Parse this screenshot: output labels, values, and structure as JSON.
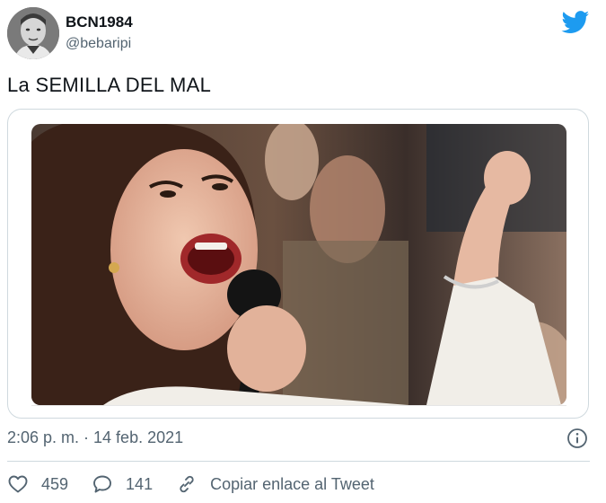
{
  "author": {
    "display_name": "BCN1984",
    "handle": "@bebaripi"
  },
  "tweet": {
    "text": "La SEMILLA DEL MAL",
    "timestamp": "2:06 p. m. · 14 feb. 2021"
  },
  "actions": {
    "likes": "459",
    "replies": "141",
    "copy_link_label": "Copiar enlace al Tweet"
  },
  "icons": {
    "brand": "twitter-bird-icon",
    "info": "info-icon",
    "like": "heart-icon",
    "reply": "reply-bubble-icon",
    "copy": "link-icon"
  },
  "colors": {
    "twitter_blue": "#1d9bf0",
    "secondary_text": "#536471",
    "border": "#cfd9de"
  }
}
